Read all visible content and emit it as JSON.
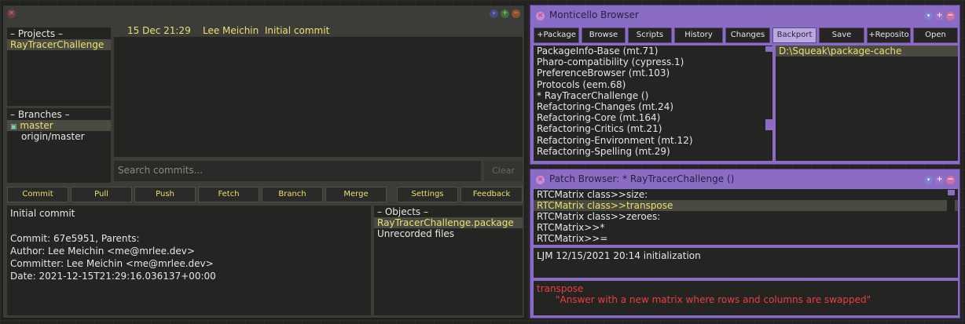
{
  "git_browser": {
    "window_controls": {
      "close": "×",
      "minimize": "▾",
      "expand": "+",
      "collapse": "−"
    },
    "projects": {
      "header": "– Projects –",
      "items": [
        "RayTracerChallenge"
      ]
    },
    "branches": {
      "header": "– Branches –",
      "items": [
        "master",
        "origin/master"
      ],
      "current_marker": "▣"
    },
    "commit_headline": {
      "date": "15 Dec 21:29",
      "author": "Lee Meichin",
      "message": "Initial commit"
    },
    "search": {
      "placeholder": "Search commits...",
      "clear_label": "Clear"
    },
    "toolbar": [
      "Commit",
      "Pull",
      "Push",
      "Fetch",
      "Branch",
      "Merge",
      "Settings",
      "Feedback"
    ],
    "commit_detail": [
      "Initial commit",
      "",
      "Commit: 67e5951, Parents:",
      "Author: Lee Meichin <me@mrlee.dev>",
      "Committer: Lee Meichin <me@mrlee.dev>",
      "Date: 2021-12-15T21:29:16.036137+00:00"
    ],
    "objects": {
      "header": "– Objects –",
      "items": [
        "RayTracerChallenge.package",
        "Unrecorded files"
      ]
    }
  },
  "monticello": {
    "title": "Monticello Browser",
    "toolbar": [
      "+Package",
      "Browse",
      "Scripts",
      "History",
      "Changes",
      "Backport",
      "Save",
      "+Reposito",
      "Open"
    ],
    "active_button": "Backport",
    "packages": [
      "PackageInfo-Base (mt.71)",
      "Pharo-compatibility (cypress.1)",
      "PreferenceBrowser (mt.103)",
      "Protocols (eem.68)",
      "* RayTracerChallenge ()",
      "Refactoring-Changes (mt.24)",
      "Refactoring-Core (mt.164)",
      "Refactoring-Critics (mt.21)",
      "Refactoring-Environment (mt.12)",
      "Refactoring-Spelling (mt.29)"
    ],
    "repositories": [
      "D:\\Squeak\\package-cache"
    ]
  },
  "patch_browser": {
    "title": "Patch Browser: * RayTracerChallenge ()",
    "items": [
      "RTCMatrix class>>size:",
      "RTCMatrix class>>transpose",
      "RTCMatrix class>>zeroes:",
      "RTCMatrix>>*",
      "RTCMatrix>>="
    ],
    "selected_index": 1,
    "info": "LJM 12/15/2021 20:14 initialization",
    "source_selector": "transpose",
    "source_comment": "\"Answer with a new matrix where rows and columns are swapped\""
  },
  "colors": {
    "highlight_text": "#e8e070",
    "monticello_frame": "#8a6cc4",
    "removed_source": "#e84040"
  }
}
